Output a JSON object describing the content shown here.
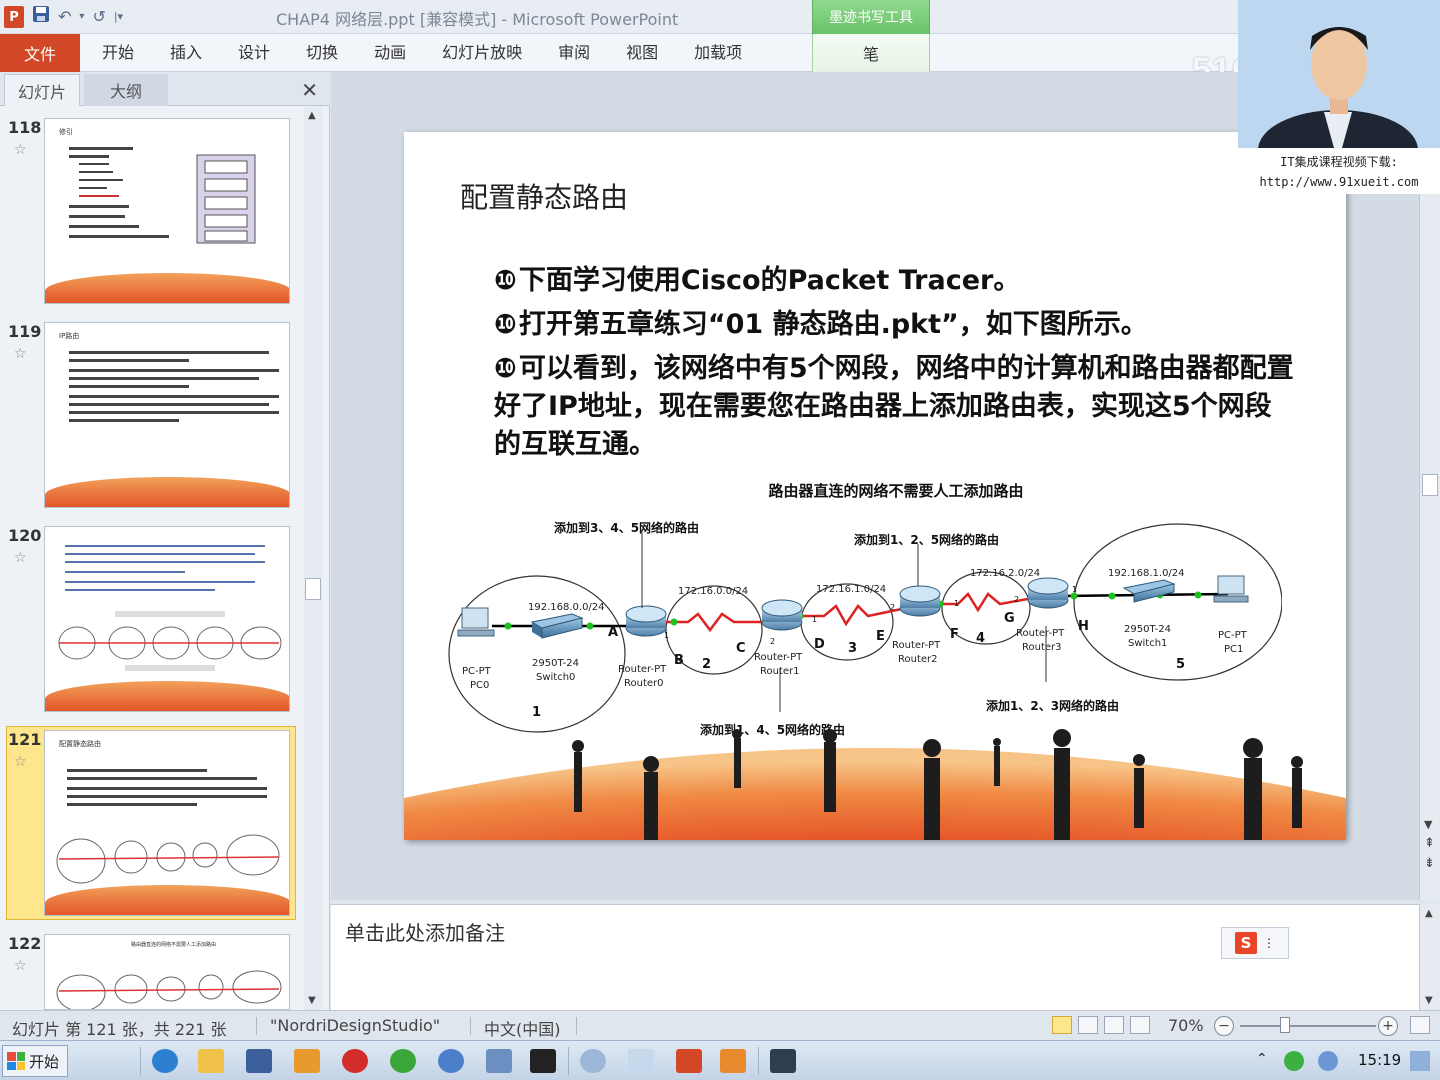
{
  "window": {
    "title": "CHAP4 网络层.ppt [兼容模式] - Microsoft PowerPoint",
    "context_tab_group": "墨迹书写工具"
  },
  "ribbon": {
    "file_tab": "文件",
    "tabs": [
      "开始",
      "插入",
      "设计",
      "切换",
      "动画",
      "幻灯片放映",
      "审阅",
      "视图",
      "加载项"
    ],
    "pen_tab": "笔"
  },
  "watermark": {
    "logo_text": "51CTO学院"
  },
  "presenter": {
    "caption_line1": "IT集成课程视频下载:",
    "caption_line2": "http://www.91xueit.com"
  },
  "left_pane": {
    "tab_slides": "幻灯片",
    "tab_outline": "大纲",
    "close_label": "✕",
    "thumbnails": [
      {
        "number": "118",
        "star": "☆",
        "title": "修引"
      },
      {
        "number": "119",
        "star": "☆",
        "title": "IP路由"
      },
      {
        "number": "120",
        "star": "☆",
        "title": ""
      },
      {
        "number": "121",
        "star": "☆",
        "title": "配置静态路由",
        "selected": true
      },
      {
        "number": "122",
        "star": "☆",
        "title": "路由器直连的网络不需要人工添加路由"
      }
    ]
  },
  "slide": {
    "title": "配置静态路由",
    "bullet_mark": "❿",
    "bullets": [
      "下面学习使用Cisco的Packet Tracer。",
      "打开第五章练习“01 静态路由.pkt”，如下图所示。",
      "可以看到，该网络中有5个网段，网络中的计算机和路由器都配置好了IP地址，现在需要您在路由器上添加路由表，实现这5个网段的互联互通。"
    ],
    "diagram": {
      "heading": "路由器直连的网络不需要人工添加路由",
      "annotations": {
        "router0": "添加到3、4、5网络的路由",
        "router1": "添加到1、4、5网络的路由",
        "router2": "添加到1、2、5网络的路由",
        "router3": "添加1、2、3网络的路由"
      },
      "networks": [
        {
          "label": "192.168.0.0/24",
          "id": "1"
        },
        {
          "label": "172.16.0.0/24",
          "id": "2"
        },
        {
          "label": "172.16.1.0/24",
          "id": "3"
        },
        {
          "label": "172.16.2.0/24",
          "id": "4"
        },
        {
          "label": "192.168.1.0/24",
          "id": "5"
        }
      ],
      "devices": {
        "pc0": [
          "PC-PT",
          "PC0"
        ],
        "switch0": [
          "2950T-24",
          "Switch0"
        ],
        "router0": [
          "Router-PT",
          "Router0"
        ],
        "router1": [
          "Router-PT",
          "Router1"
        ],
        "router2": [
          "Router-PT",
          "Router2"
        ],
        "router3": [
          "Router-PT",
          "Router3"
        ],
        "switch1": [
          "2950T-24",
          "Switch1"
        ],
        "pc1": [
          "PC-PT",
          "PC1"
        ]
      },
      "interfaces": [
        "A",
        "B",
        "C",
        "D",
        "E",
        "F",
        "G",
        "H"
      ],
      "port_numbers": [
        "1",
        "2"
      ]
    }
  },
  "notes": {
    "placeholder": "单击此处添加备注",
    "ime_label": "S"
  },
  "status": {
    "slide_info": "幻灯片 第 121 张，共 221 张",
    "theme": "\"NordriDesignStudio\"",
    "language": "中文(中国)",
    "zoom": "70%",
    "zoom_out": "−",
    "zoom_in": "+"
  },
  "taskbar": {
    "start_label": "开始",
    "clock": "15:19"
  }
}
